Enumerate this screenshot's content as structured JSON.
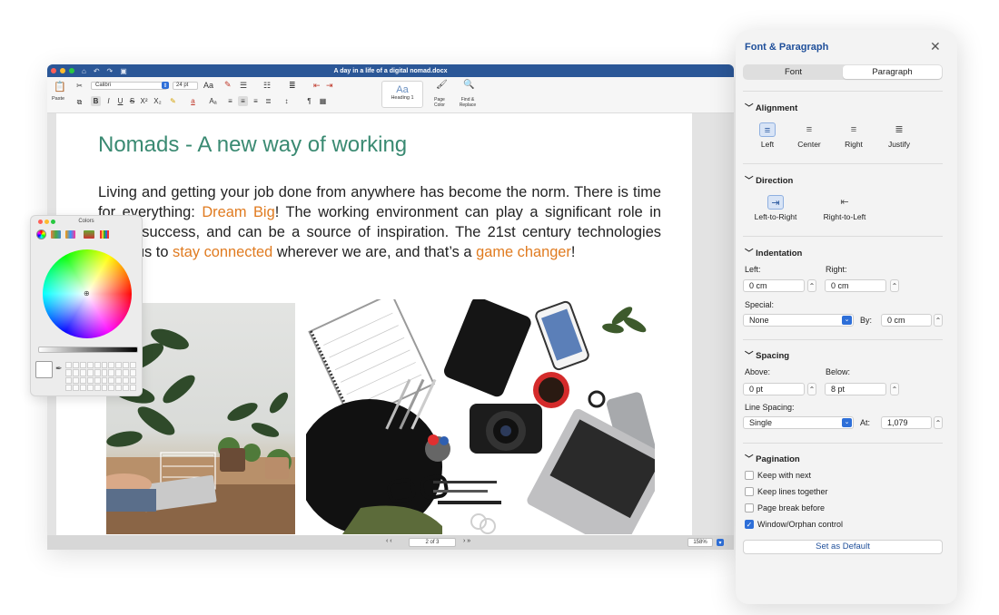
{
  "window": {
    "doc_title": "A day in a life of a digital nomad.docx",
    "font_name": "Calibri",
    "font_size": "24 pt",
    "style_preview": "Aa",
    "style_name": "Heading 1",
    "paste_label": "Paste",
    "page_color_label": "Page Color",
    "find_replace_label": "Find & Replace",
    "pager": "2 of 3",
    "zoom": "158%"
  },
  "document": {
    "heading": "Nomads - A new way of working",
    "p1": "Living and getting your job done from anywhere has become the norm. There is time for everything: ",
    "hl1": "Dream Big",
    "p2": "! The working environment can play a significant role in home success, and can be a source of inspiration. The 21st century technologies allow us to ",
    "hl2": "stay connected",
    "p3": " wherever we are, and that’s a ",
    "hl3": "game changer",
    "p4": "!"
  },
  "colors_panel": {
    "title": "Colors"
  },
  "panel": {
    "title": "Font & Paragraph",
    "tabs": [
      "Font",
      "Paragraph"
    ],
    "alignment": {
      "title": "Alignment",
      "options": [
        "Left",
        "Center",
        "Right",
        "Justify"
      ],
      "selected": "Left"
    },
    "direction": {
      "title": "Direction",
      "options": [
        "Left-to-Right",
        "Right-to-Left"
      ],
      "selected": "Left-to-Right"
    },
    "indentation": {
      "title": "Indentation",
      "left_label": "Left:",
      "left_value": "0 cm",
      "right_label": "Right:",
      "right_value": "0 cm",
      "special_label": "Special:",
      "special_value": "None",
      "by_label": "By:",
      "by_value": "0 cm"
    },
    "spacing": {
      "title": "Spacing",
      "above_label": "Above:",
      "above_value": "0 pt",
      "below_label": "Below:",
      "below_value": "8 pt",
      "line_label": "Line Spacing:",
      "line_value": "Single",
      "at_label": "At:",
      "at_value": "1,079"
    },
    "pagination": {
      "title": "Pagination",
      "items": [
        {
          "label": "Keep with next",
          "checked": false
        },
        {
          "label": "Keep lines together",
          "checked": false
        },
        {
          "label": "Page break before",
          "checked": false
        },
        {
          "label": "Window/Orphan control",
          "checked": true
        }
      ]
    },
    "default_button": "Set as Default"
  }
}
